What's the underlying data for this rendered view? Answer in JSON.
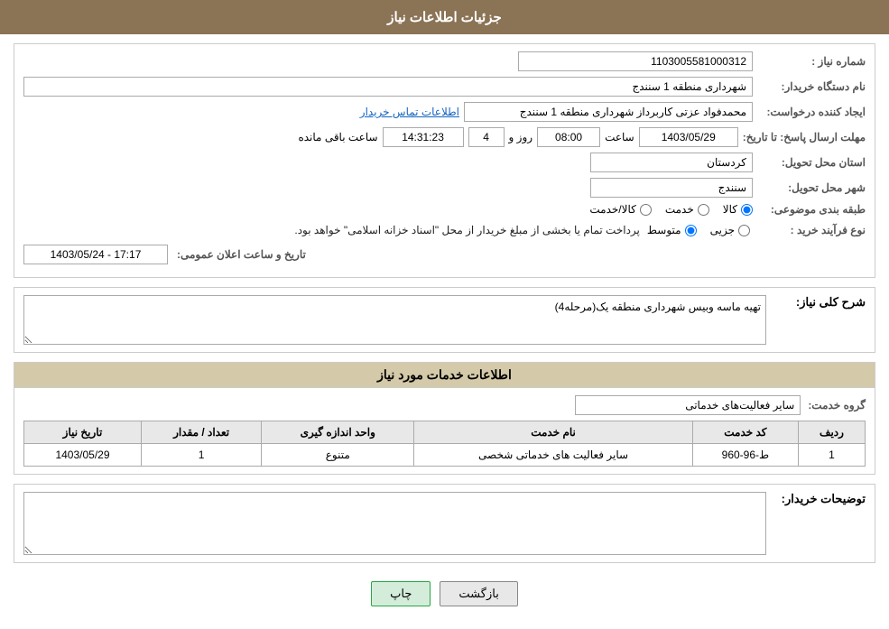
{
  "header": {
    "title": "جزئیات اطلاعات نیاز"
  },
  "form": {
    "shomara_niaz_label": "شماره نیاز :",
    "shomara_niaz_value": "1103005581000312",
    "nam_dastgah_label": "نام دستگاه خریدار:",
    "nam_dastgah_value": "شهرداری منطقه 1 سنندج",
    "eijad_label": "ایجاد کننده درخواست:",
    "eijad_value": "محمدفواد عزتی کاربرداز شهرداری منطقه 1 سنندج",
    "ettelaat_link": "اطلاعات تماس خریدار",
    "mohlat_label": "مهلت ارسال پاسخ: تا تاریخ:",
    "mohlat_date": "1403/05/29",
    "mohlat_saat_label": "ساعت",
    "mohlat_saat": "08:00",
    "mohlat_roz_label": "روز و",
    "mohlat_roz": "4",
    "mohlat_baqi": "14:31:23",
    "mohlat_baqi_label": "ساعت باقی مانده",
    "ostan_label": "استان محل تحویل:",
    "ostan_value": "کردستان",
    "shahr_label": "شهر محل تحویل:",
    "shahr_value": "سنندج",
    "tabaqe_label": "طبقه بندی موضوعی:",
    "tabaqe_options": [
      {
        "label": "کالا",
        "value": "kala"
      },
      {
        "label": "خدمت",
        "value": "khedmat"
      },
      {
        "label": "کالا/خدمت",
        "value": "kala_khedmat"
      }
    ],
    "tabaqe_selected": "kala",
    "nofarayand_label": "نوع فرآیند خرید :",
    "nofarayand_options": [
      {
        "label": "جزیی",
        "value": "jozi"
      },
      {
        "label": "متوسط",
        "value": "motevaset"
      }
    ],
    "nofarayand_selected": "motevaset",
    "notice_text": "پرداخت تمام یا بخشی از مبلغ خریدار از محل \"اسناد خزانه اسلامی\" خواهد بود.",
    "tarikh_saat_label": "تاریخ و ساعت اعلان عمومی:",
    "tarikh_saat_value": "1403/05/24 - 17:17",
    "sharh_section": "شرح کلی نیاز:",
    "sharh_value": "تهیه ماسه وبیس شهرداری منطقه یک(مرحله4)",
    "khadamat_section": "اطلاعات خدمات مورد نیاز",
    "grouh_label": "گروه خدمت:",
    "grouh_value": "سایر فعالیت‌های خدماتی",
    "table": {
      "headers": [
        "ردیف",
        "کد خدمت",
        "نام خدمت",
        "واحد اندازه گیری",
        "تعداد / مقدار",
        "تاریخ نیاز"
      ],
      "rows": [
        {
          "radif": "1",
          "kod_khedmat": "ط-96-960",
          "nam_khedmat": "سایر فعالیت های خدماتی شخصی",
          "vahed": "متنوع",
          "tedad": "1",
          "tarikh": "1403/05/29"
        }
      ]
    },
    "tozihat_label": "توضیحات خریدار:",
    "tozihat_value": ""
  },
  "buttons": {
    "print_label": "چاپ",
    "back_label": "بازگشت"
  }
}
